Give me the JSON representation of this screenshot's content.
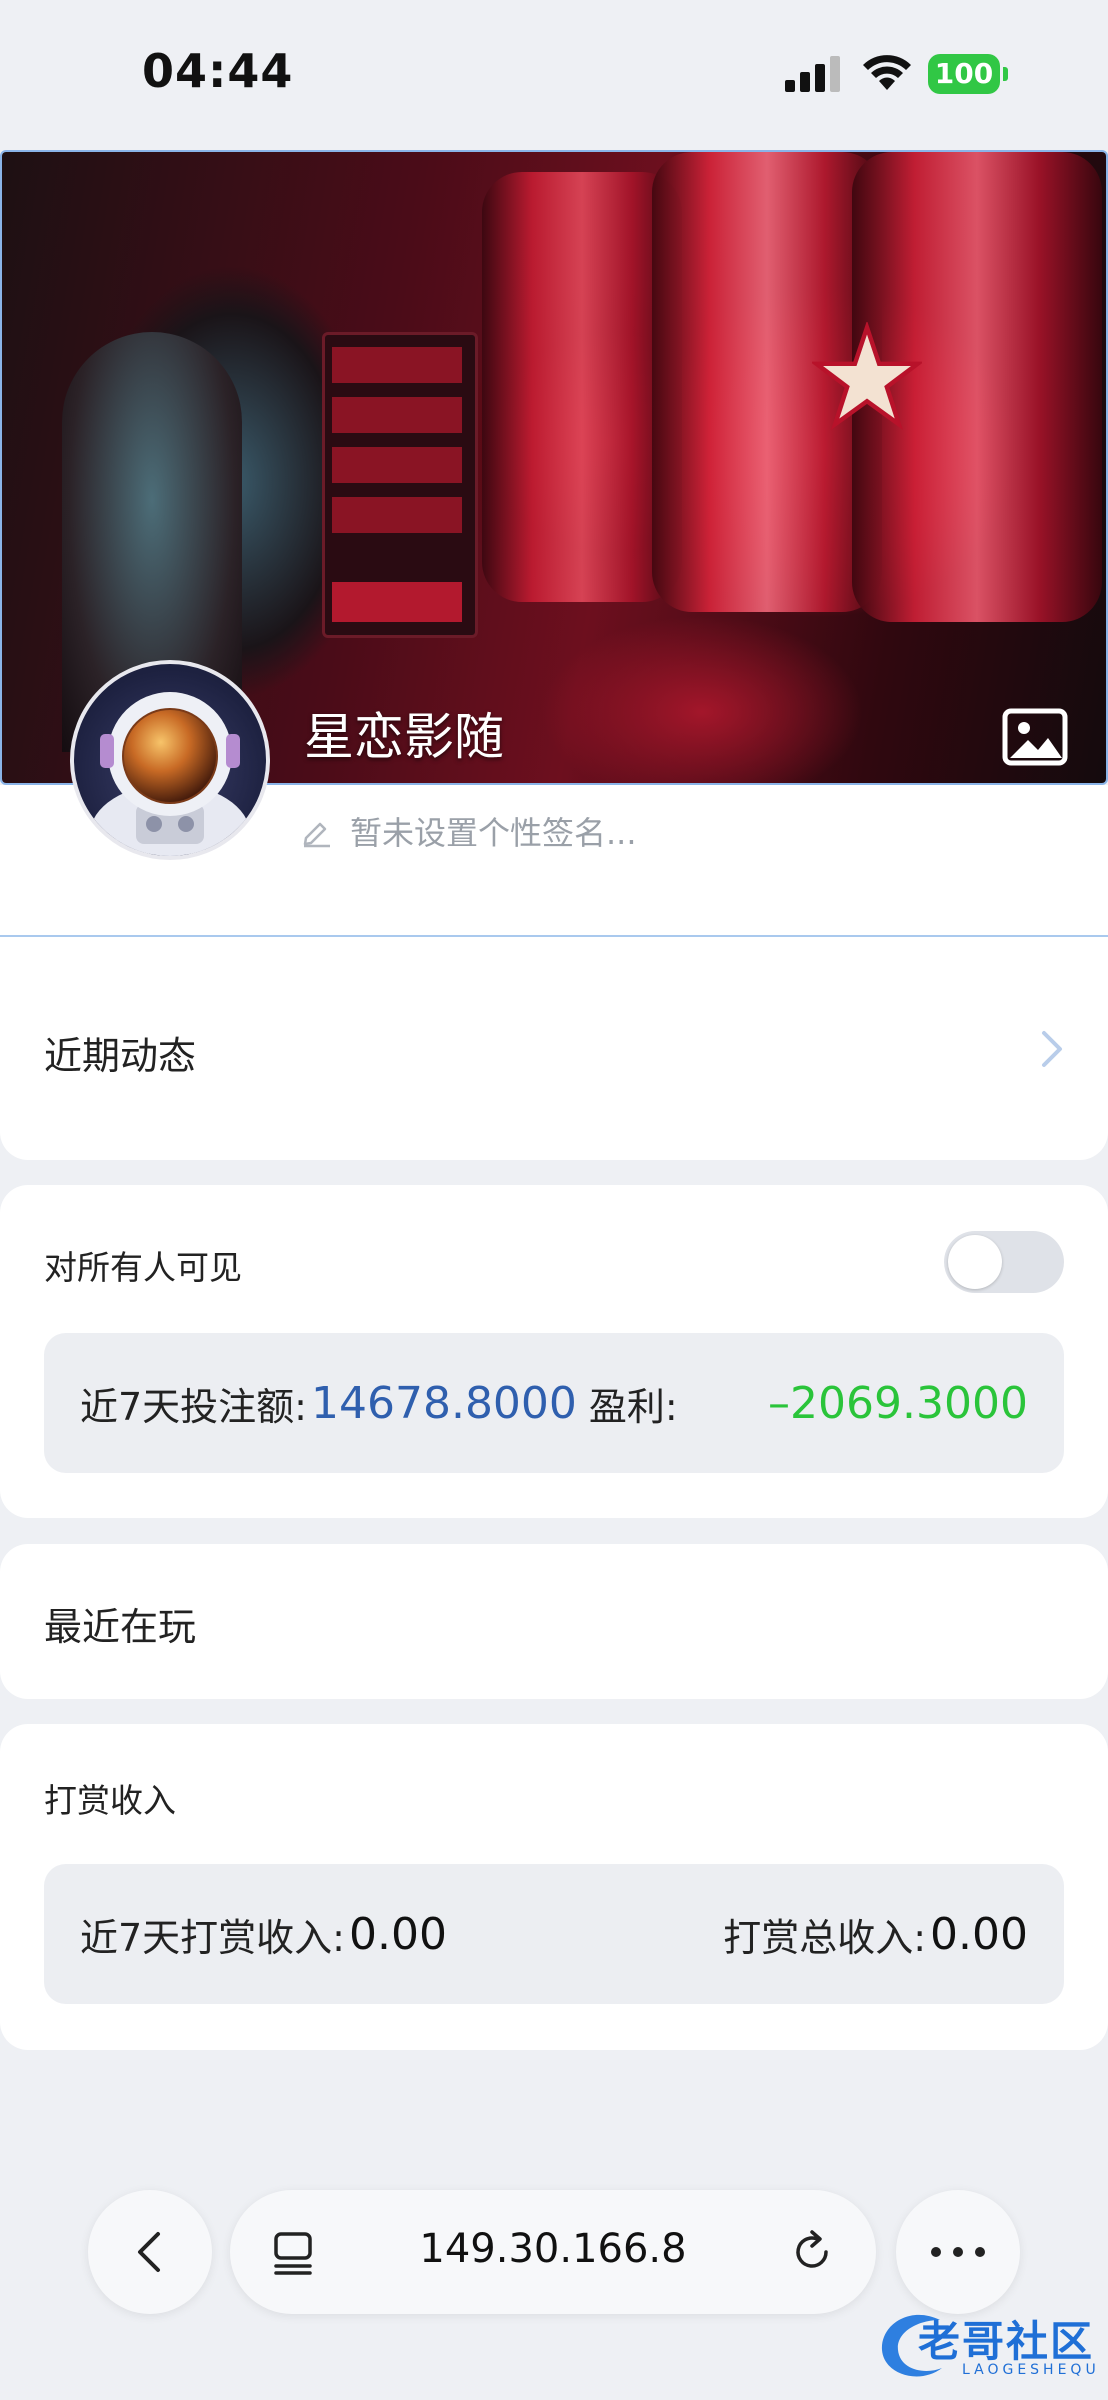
{
  "status_bar": {
    "time": "04:44",
    "battery": "100"
  },
  "profile": {
    "name": "星恋影随",
    "signature": "暂未设置个性签名..."
  },
  "recent_activity": {
    "label": "近期动态"
  },
  "visibility": {
    "label": "对所有人可见",
    "toggle_on": false,
    "bet_label": "近7天投注额:",
    "bet_value": "14678.8000",
    "profit_label": "盈利:",
    "profit_value": "–2069.3000"
  },
  "recently_playing": {
    "label": "最近在玩"
  },
  "tips": {
    "label": "打赏收入",
    "week_label": "近7天打赏收入:",
    "week_value": "0.00",
    "total_label": "打赏总收入:",
    "total_value": "0.00"
  },
  "browser": {
    "url": "149.30.166.8"
  },
  "watermark": {
    "text": "老哥社区",
    "sub": "LAOGESHEQU"
  },
  "colors": {
    "accent_blue": "#2f5fae",
    "profit_green": "#2ac43a",
    "battery_green": "#31c745"
  }
}
